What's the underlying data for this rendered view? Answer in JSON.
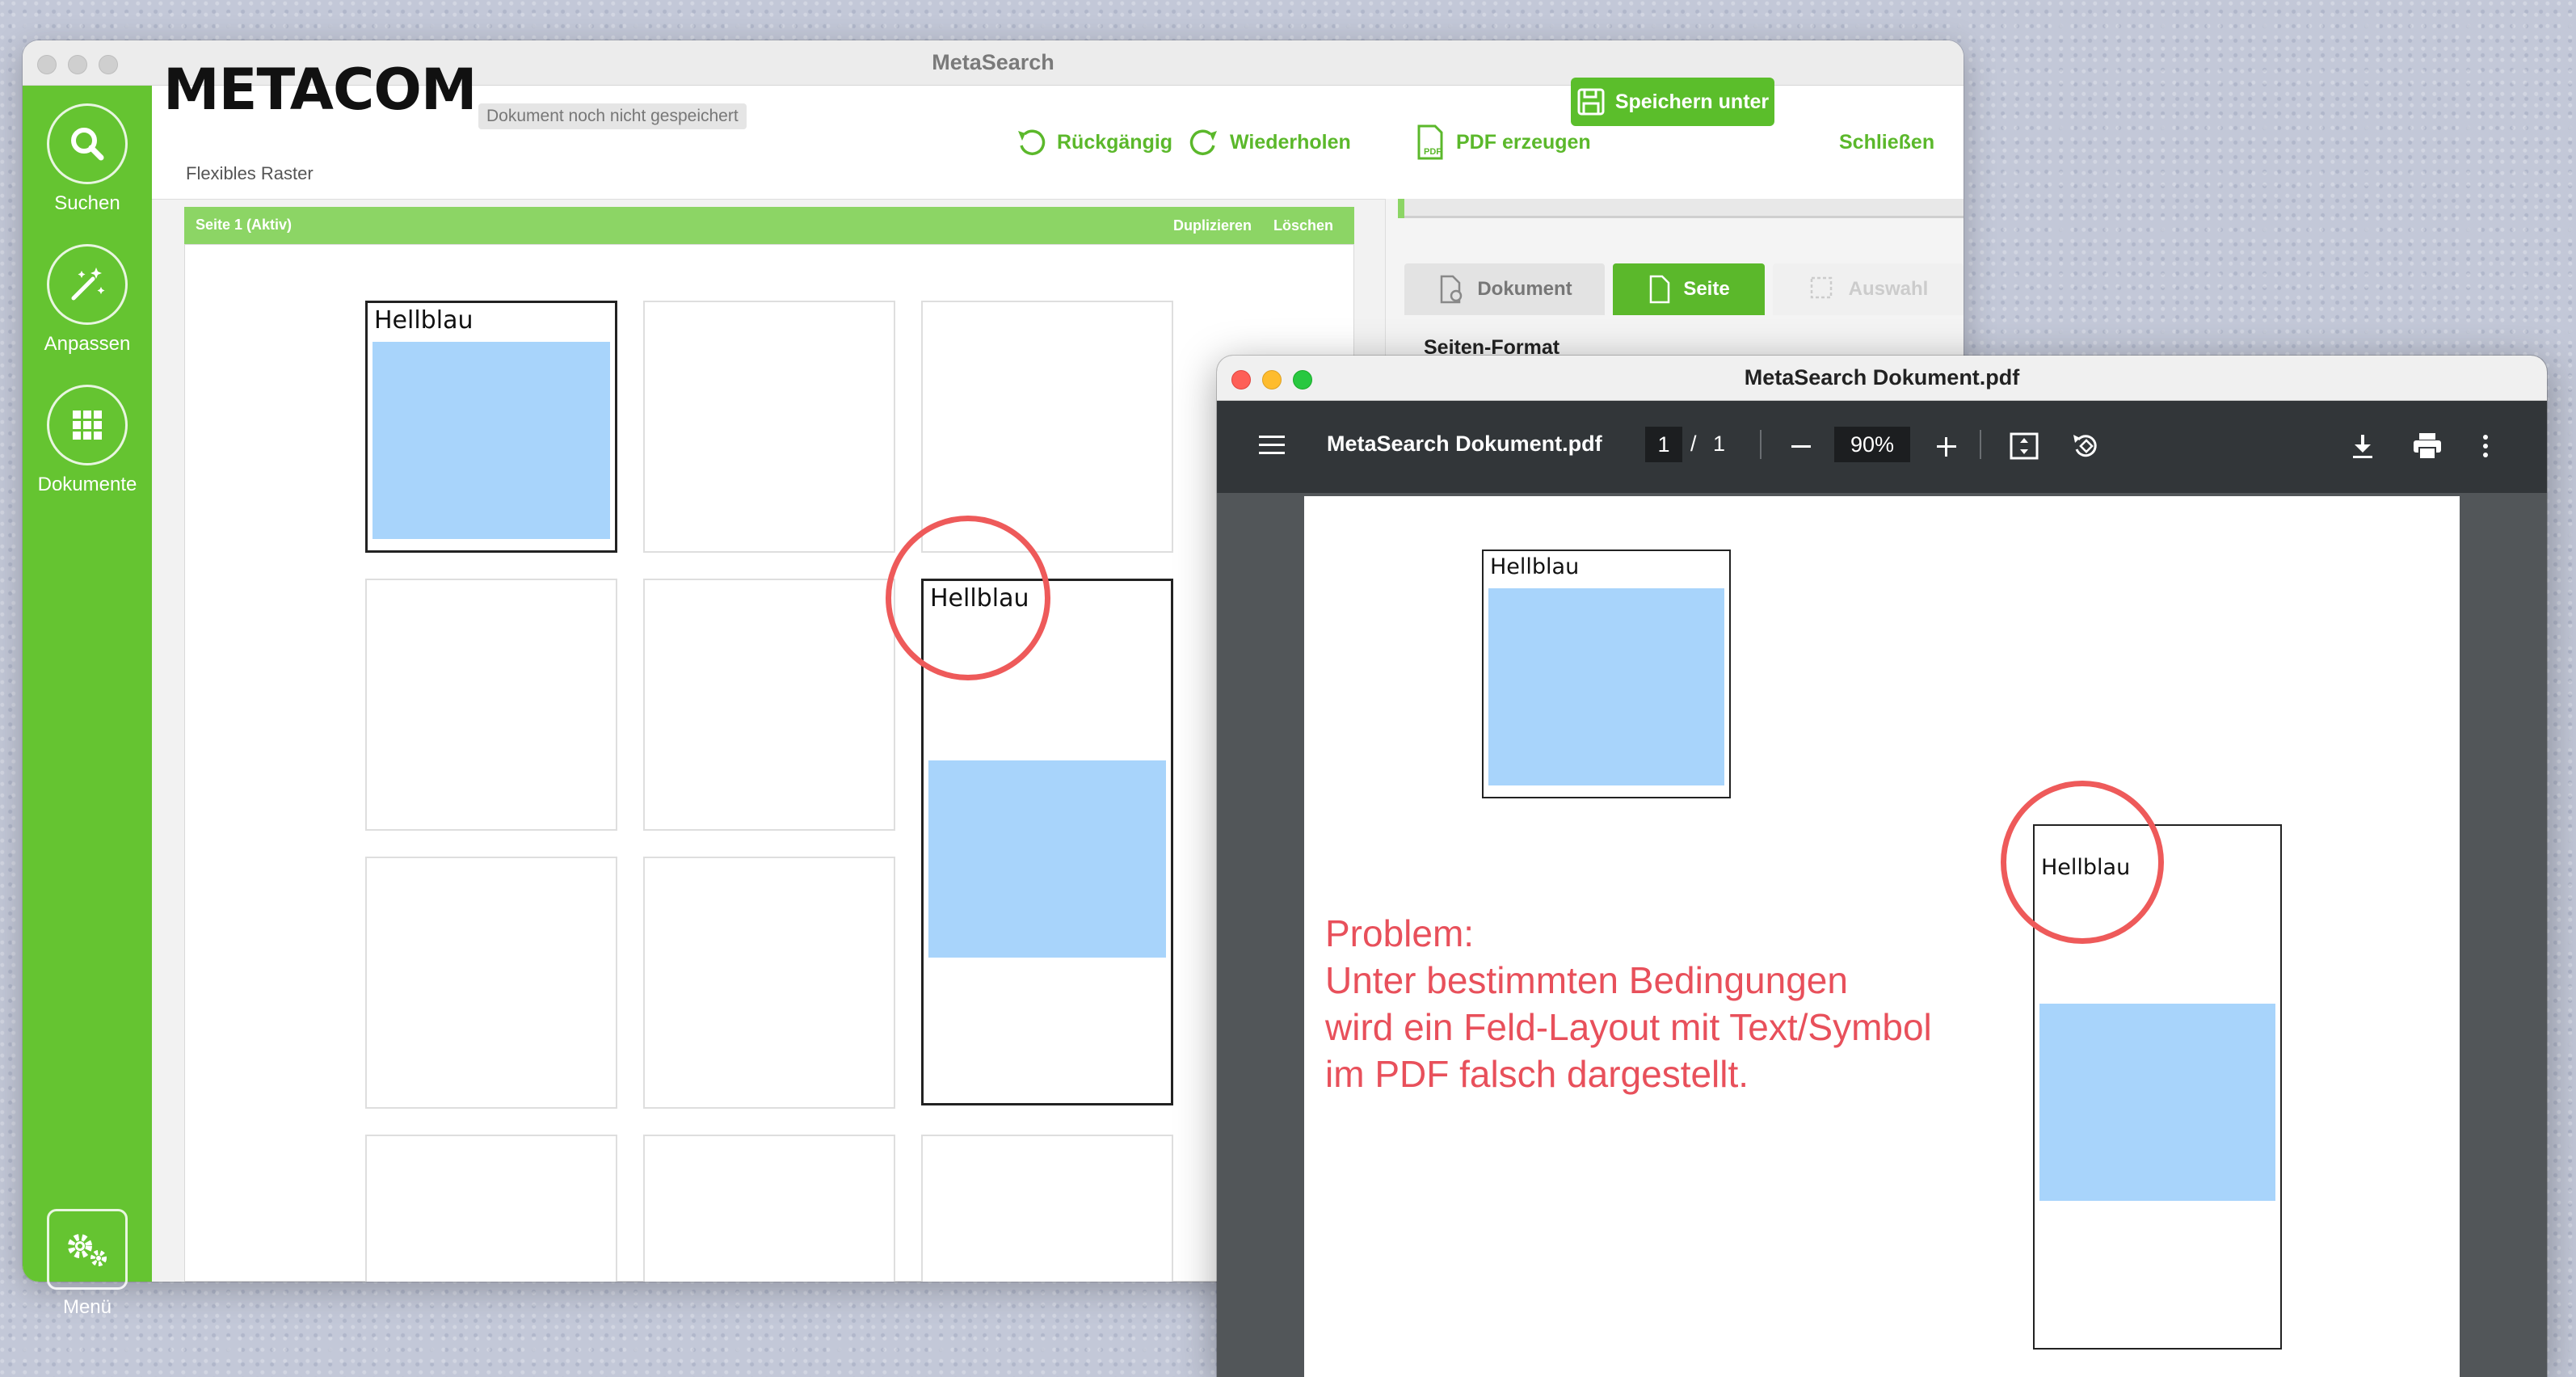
{
  "win1": {
    "title": "MetaSearch",
    "brand": "METACOM",
    "subtitle": "Flexibles Raster",
    "status_badge": "Dokument noch nicht gespeichert",
    "toolbar": {
      "undo": "Rückgängig",
      "redo": "Wiederholen",
      "pdf": "PDF erzeugen",
      "save_as": "Speichern unter",
      "close": "Schließen"
    },
    "sidebar": {
      "search": "Suchen",
      "adjust": "Anpassen",
      "documents": "Dokumente",
      "menu": "Menü"
    },
    "page_bar": {
      "label": "Seite 1 (Aktiv)",
      "duplicate": "Duplizieren",
      "delete": "Löschen"
    },
    "cells": {
      "cell_1_label": "Hellblau",
      "cell_6_label": "Hellblau"
    },
    "right_panel": {
      "tab_document": "Dokument",
      "tab_page": "Seite",
      "tab_selection": "Auswahl",
      "section_title": "Seiten-Format"
    }
  },
  "win2": {
    "title": "MetaSearch Dokument.pdf",
    "toolbar": {
      "filename": "MetaSearch Dokument.pdf",
      "page_current": "1",
      "page_sep": "/",
      "page_total": "1",
      "zoom": "90%"
    },
    "cells": {
      "cell_a_label": "Hellblau",
      "cell_b_label": "Hellblau"
    }
  },
  "annotation": {
    "line1": "Problem:",
    "line2": "Unter bestimmten Bedingungen",
    "line3": "wird ein Feld-Layout mit Text/Symbol",
    "line4": "im PDF falsch dargestellt."
  },
  "colors": {
    "brand_green": "#65c431",
    "accent_green": "#5bb82b",
    "light_blue": "#a8d4fb",
    "annotation_red": "#ee5a5a",
    "pdf_toolbar": "#323639"
  },
  "icons": [
    "search-icon",
    "magic-wand-icon",
    "grid-icon",
    "gears-icon",
    "undo-icon",
    "redo-icon",
    "pdf-icon",
    "save-icon",
    "menu-icon",
    "minus-icon",
    "plus-icon",
    "fit-page-icon",
    "rotate-icon",
    "download-icon",
    "print-icon",
    "more-vertical-icon",
    "document-gear-icon",
    "page-icon",
    "selection-icon"
  ]
}
